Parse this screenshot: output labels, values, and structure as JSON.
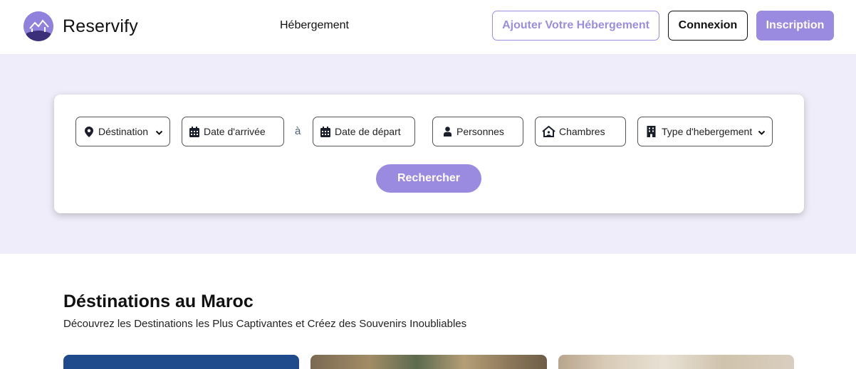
{
  "brand": {
    "name": "Reservify"
  },
  "nav": {
    "hebergement": "Hébergement"
  },
  "actions": {
    "add_listing": "Ajouter Votre Hébergement",
    "login": "Connexion",
    "signup": "Inscription"
  },
  "search": {
    "destination": "Déstination",
    "arrival": "Date d'arrivée",
    "separator": "à",
    "departure": "Date de départ",
    "persons": "Personnes",
    "rooms": "Chambres",
    "type": "Type d'hebergement",
    "submit": "Rechercher"
  },
  "section": {
    "title": "Déstinations au Maroc",
    "subtitle": "Découvrez les Destinations les Plus Captivantes et Créez des Souvenirs Inoubliables"
  },
  "colors": {
    "accent": "#9a8ae0",
    "hero_bg": "#eeedf9"
  },
  "icons": [
    "logo-house-icon",
    "map-pin-icon",
    "calendar-icon",
    "user-icon",
    "house-icon",
    "building-icon",
    "chevron-down-icon"
  ]
}
